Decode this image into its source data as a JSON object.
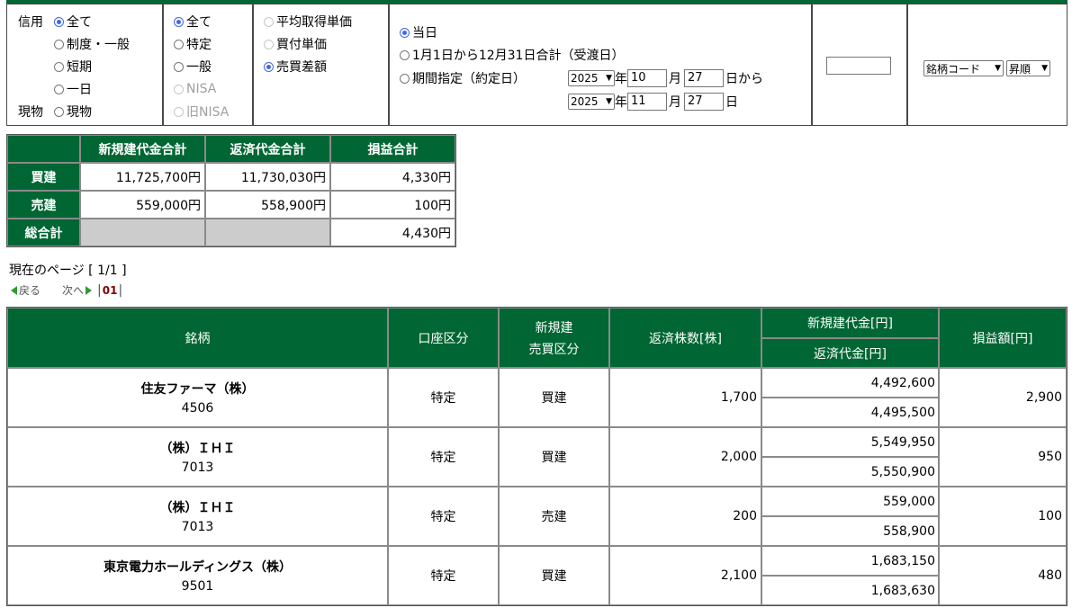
{
  "filters": {
    "credit_label": "信用",
    "cash_label": "現物",
    "trade_type": [
      {
        "label": "全て",
        "checked": true
      },
      {
        "label": "制度・一般",
        "checked": false
      },
      {
        "label": "短期",
        "checked": false
      },
      {
        "label": "一日",
        "checked": false
      },
      {
        "label": "現物",
        "checked": false
      }
    ],
    "account_type": [
      {
        "label": "全て",
        "checked": true
      },
      {
        "label": "特定",
        "checked": false
      },
      {
        "label": "一般",
        "checked": false
      },
      {
        "label": "NISA",
        "checked": false,
        "disabled": true
      },
      {
        "label": "旧NISA",
        "checked": false,
        "disabled": true
      }
    ],
    "price_type": [
      {
        "label": "平均取得単価",
        "checked": false,
        "disabled": true
      },
      {
        "label": "買付単価",
        "checked": false,
        "disabled": true
      },
      {
        "label": "売買差額",
        "checked": true
      }
    ],
    "period": [
      {
        "label": "当日",
        "checked": true
      },
      {
        "label": "1月1日から12月31日合計（受渡日）",
        "checked": false
      },
      {
        "label": "期間指定（約定日）",
        "checked": false
      }
    ],
    "from": {
      "year": "2025",
      "month": "10",
      "day": "27",
      "suffix": "日から"
    },
    "to": {
      "year": "2025",
      "month": "11",
      "day": "27",
      "suffix": "日"
    },
    "year_unit": "年",
    "month_unit": "月",
    "code_input_value": "",
    "sort_key": "銘柄コード",
    "sort_order": "昇順"
  },
  "summary": {
    "headers": [
      "新規建代金合計",
      "返済代金合計",
      "損益合計"
    ],
    "rows": [
      {
        "label": "買建",
        "new": "11,725,700円",
        "repay": "11,730,030円",
        "pl": "4,330円"
      },
      {
        "label": "売建",
        "new": "559,000円",
        "repay": "558,900円",
        "pl": "100円"
      }
    ],
    "total": {
      "label": "総合計",
      "pl": "4,430円"
    }
  },
  "pager": {
    "current_text": "現在のページ [ 1/1 ]",
    "prev": "戻る",
    "next": "次へ",
    "page": "01"
  },
  "table": {
    "headers": {
      "stock": "銘柄",
      "account": "口座区分",
      "new_trade_1": "新規建",
      "new_trade_2": "売買区分",
      "repay_qty": "返済株数[株]",
      "new_amount": "新規建代金[円]",
      "repay_amount": "返済代金[円]",
      "pl": "損益額[円]"
    },
    "rows": [
      {
        "name": "住友ファーマ（株）",
        "code": "4506",
        "account": "特定",
        "side": "買建",
        "qty": "1,700",
        "new": "4,492,600",
        "repay": "4,495,500",
        "pl": "2,900"
      },
      {
        "name": "（株）ＩＨＩ",
        "code": "7013",
        "account": "特定",
        "side": "買建",
        "qty": "2,000",
        "new": "5,549,950",
        "repay": "5,550,900",
        "pl": "950"
      },
      {
        "name": "（株）ＩＨＩ",
        "code": "7013",
        "account": "特定",
        "side": "売建",
        "qty": "200",
        "new": "559,000",
        "repay": "558,900",
        "pl": "100"
      },
      {
        "name": "東京電力ホールディングス（株）",
        "code": "9501",
        "account": "特定",
        "side": "買建",
        "qty": "2,100",
        "new": "1,683,150",
        "repay": "1,683,630",
        "pl": "480"
      }
    ]
  },
  "colors": {
    "header_green": "#006633",
    "radio_blue": "#4169e1",
    "grey_cell": "#cccccc"
  }
}
